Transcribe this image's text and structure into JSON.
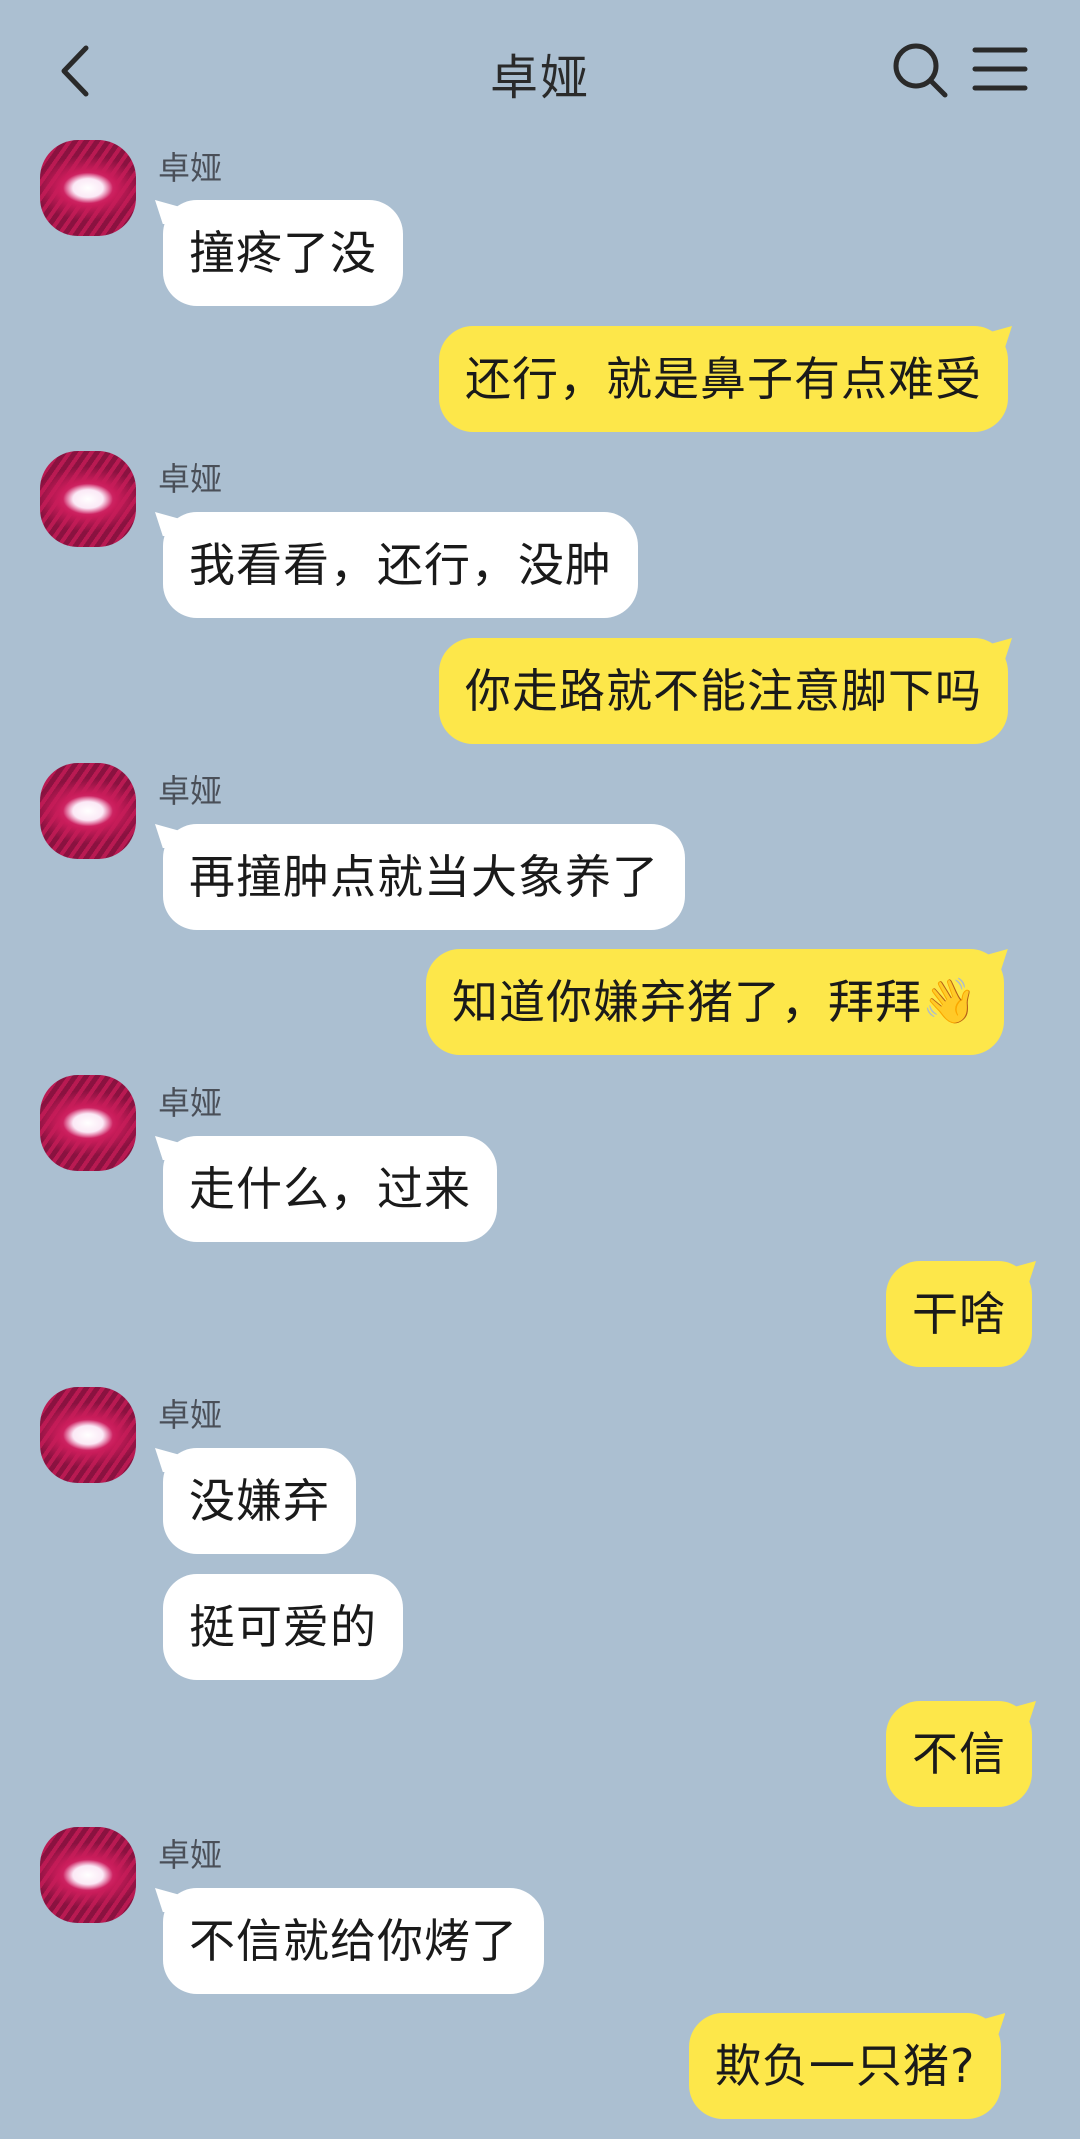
{
  "header": {
    "title": "卓娅",
    "back_icon": "chevron-left-icon",
    "search_icon": "search-icon",
    "menu_icon": "menu-icon"
  },
  "colors": {
    "background": "#abbfd1",
    "incoming_bubble": "#ffffff",
    "outgoing_bubble": "#fde74a"
  },
  "messages": [
    {
      "side": "in",
      "sender": "卓娅",
      "text": "撞疼了没"
    },
    {
      "side": "out",
      "text": "还行，就是鼻子有点难受"
    },
    {
      "side": "in",
      "sender": "卓娅",
      "text": "我看看，还行，没肿"
    },
    {
      "side": "out",
      "text": "你走路就不能注意脚下吗"
    },
    {
      "side": "in",
      "sender": "卓娅",
      "text": "再撞肿点就当大象养了"
    },
    {
      "side": "out",
      "text": "知道你嫌弃猪了，拜拜",
      "emoji": "👋"
    },
    {
      "side": "in",
      "sender": "卓娅",
      "text": "走什么，过来"
    },
    {
      "side": "out",
      "text": "干啥"
    },
    {
      "side": "in",
      "sender": "卓娅",
      "text": "没嫌弃"
    },
    {
      "side": "in",
      "text": "挺可爱的"
    },
    {
      "side": "out",
      "text": "不信"
    },
    {
      "side": "in",
      "sender": "卓娅",
      "text": "不信就给你烤了"
    },
    {
      "side": "out",
      "text": "欺负一只猪?"
    }
  ]
}
